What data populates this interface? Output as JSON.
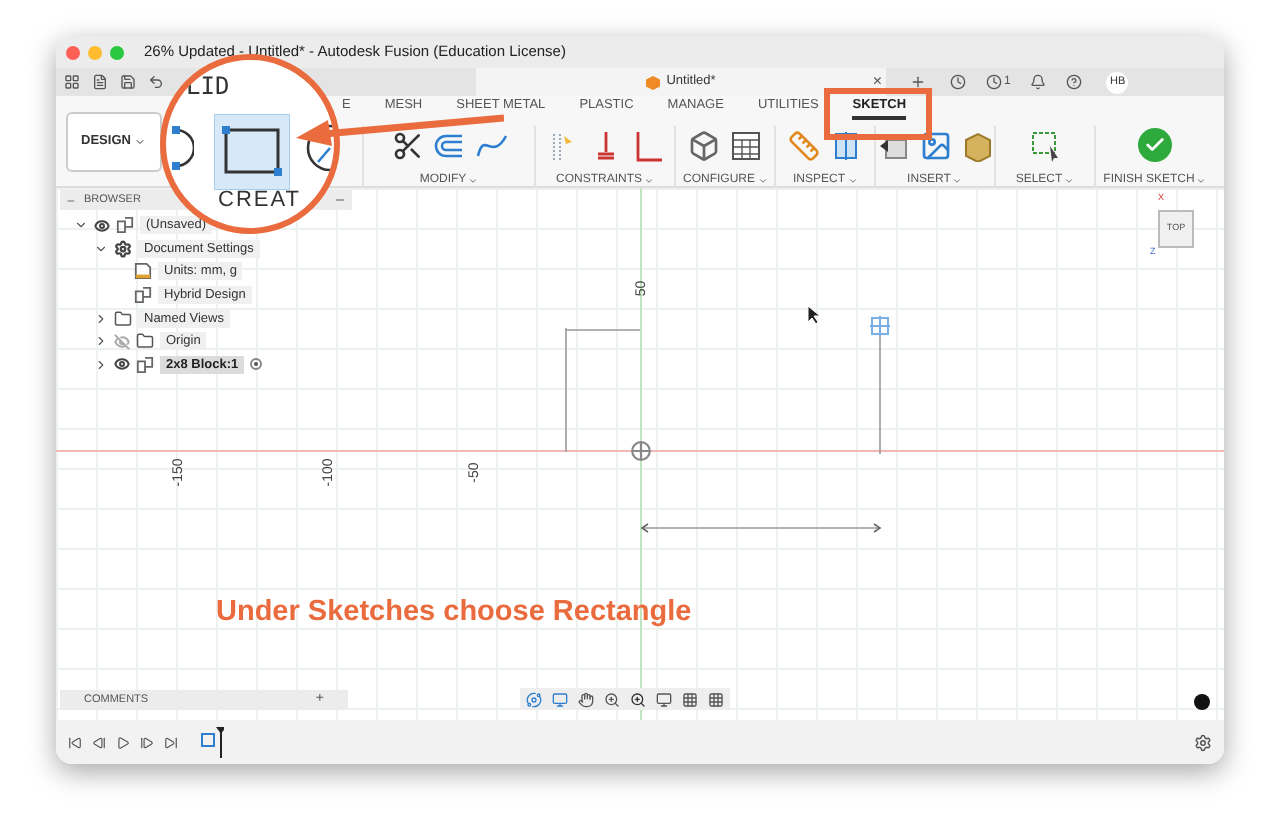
{
  "window": {
    "title": "26% Updated - Untitled* - Autodesk Fusion (Education License)"
  },
  "document_tab": {
    "title": "Untitled*",
    "close": "×"
  },
  "notifications": {
    "count": "1"
  },
  "user": {
    "initials": "HB"
  },
  "workspace": {
    "label": "DESIGN"
  },
  "ribbon_tabs": [
    {
      "label": "E",
      "selected": false
    },
    {
      "label": "MESH",
      "selected": false
    },
    {
      "label": "SHEET METAL",
      "selected": false
    },
    {
      "label": "PLASTIC",
      "selected": false
    },
    {
      "label": "MANAGE",
      "selected": false
    },
    {
      "label": "UTILITIES",
      "selected": false
    },
    {
      "label": "SKETCH",
      "selected": true
    }
  ],
  "tool_groups": [
    {
      "label": "MODIFY",
      "kind": "modify"
    },
    {
      "label": "CONSTRAINTS",
      "kind": "constraints"
    },
    {
      "label": "CONFIGURE",
      "kind": "configure"
    },
    {
      "label": "INSPECT",
      "kind": "inspect"
    },
    {
      "label": "INSERT",
      "kind": "insert"
    },
    {
      "label": "SELECT",
      "kind": "select"
    },
    {
      "label": "FINISH SKETCH",
      "kind": "finish"
    }
  ],
  "browser": {
    "title": "BROWSER",
    "items": [
      {
        "label": "(Unsaved)",
        "kind": "component",
        "visible": true,
        "expanded": true,
        "children": [
          {
            "label": "Document Settings",
            "kind": "settings",
            "expanded": true,
            "children": [
              {
                "label": "Units: mm, g",
                "kind": "units"
              },
              {
                "label": "Hybrid Design",
                "kind": "component"
              }
            ]
          },
          {
            "label": "Named Views",
            "kind": "folder",
            "expanded": false
          },
          {
            "label": "Origin",
            "kind": "folder",
            "visible": false,
            "expanded": false
          },
          {
            "label": "2x8 Block:1",
            "kind": "component",
            "visible": true,
            "expanded": false,
            "active": true
          }
        ]
      }
    ]
  },
  "canvas": {
    "vertical_axis_label": "50",
    "horizontal_axis_labels": [
      "-150",
      "-100",
      "-50"
    ],
    "view_cube": {
      "face": "TOP",
      "axes": [
        "Z",
        "X"
      ]
    }
  },
  "comments": {
    "title": "COMMENTS",
    "add": "+"
  },
  "annotation": {
    "magnifier_texts": [
      "LID",
      "CREAT"
    ],
    "caption": "Under Sketches choose Rectangle"
  }
}
